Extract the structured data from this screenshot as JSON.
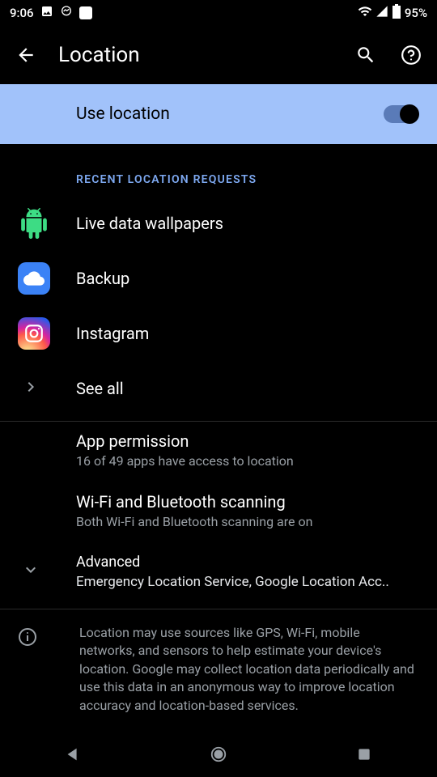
{
  "status": {
    "time": "9:06",
    "battery": "95%"
  },
  "header": {
    "title": "Location"
  },
  "toggle": {
    "label": "Use location",
    "on": true
  },
  "recent": {
    "header": "RECENT LOCATION REQUESTS",
    "items": [
      {
        "label": "Live data wallpapers",
        "icon": "android"
      },
      {
        "label": "Backup",
        "icon": "backup"
      },
      {
        "label": "Instagram",
        "icon": "instagram"
      }
    ],
    "see_all": "See all"
  },
  "settings": {
    "app_permission": {
      "title": "App permission",
      "subtitle": "16 of 49 apps have access to location"
    },
    "scanning": {
      "title": "Wi-Fi and Bluetooth scanning",
      "subtitle": "Both Wi-Fi and Bluetooth scanning are on"
    },
    "advanced": {
      "title": "Advanced",
      "subtitle": "Emergency Location Service, Google Location Acc.."
    }
  },
  "info_text": "Location may use sources like GPS, Wi-Fi, mobile networks, and sensors to help estimate your device's location. Google may collect location data periodically and use this data in an anonymous way to improve location accuracy and location-based services."
}
